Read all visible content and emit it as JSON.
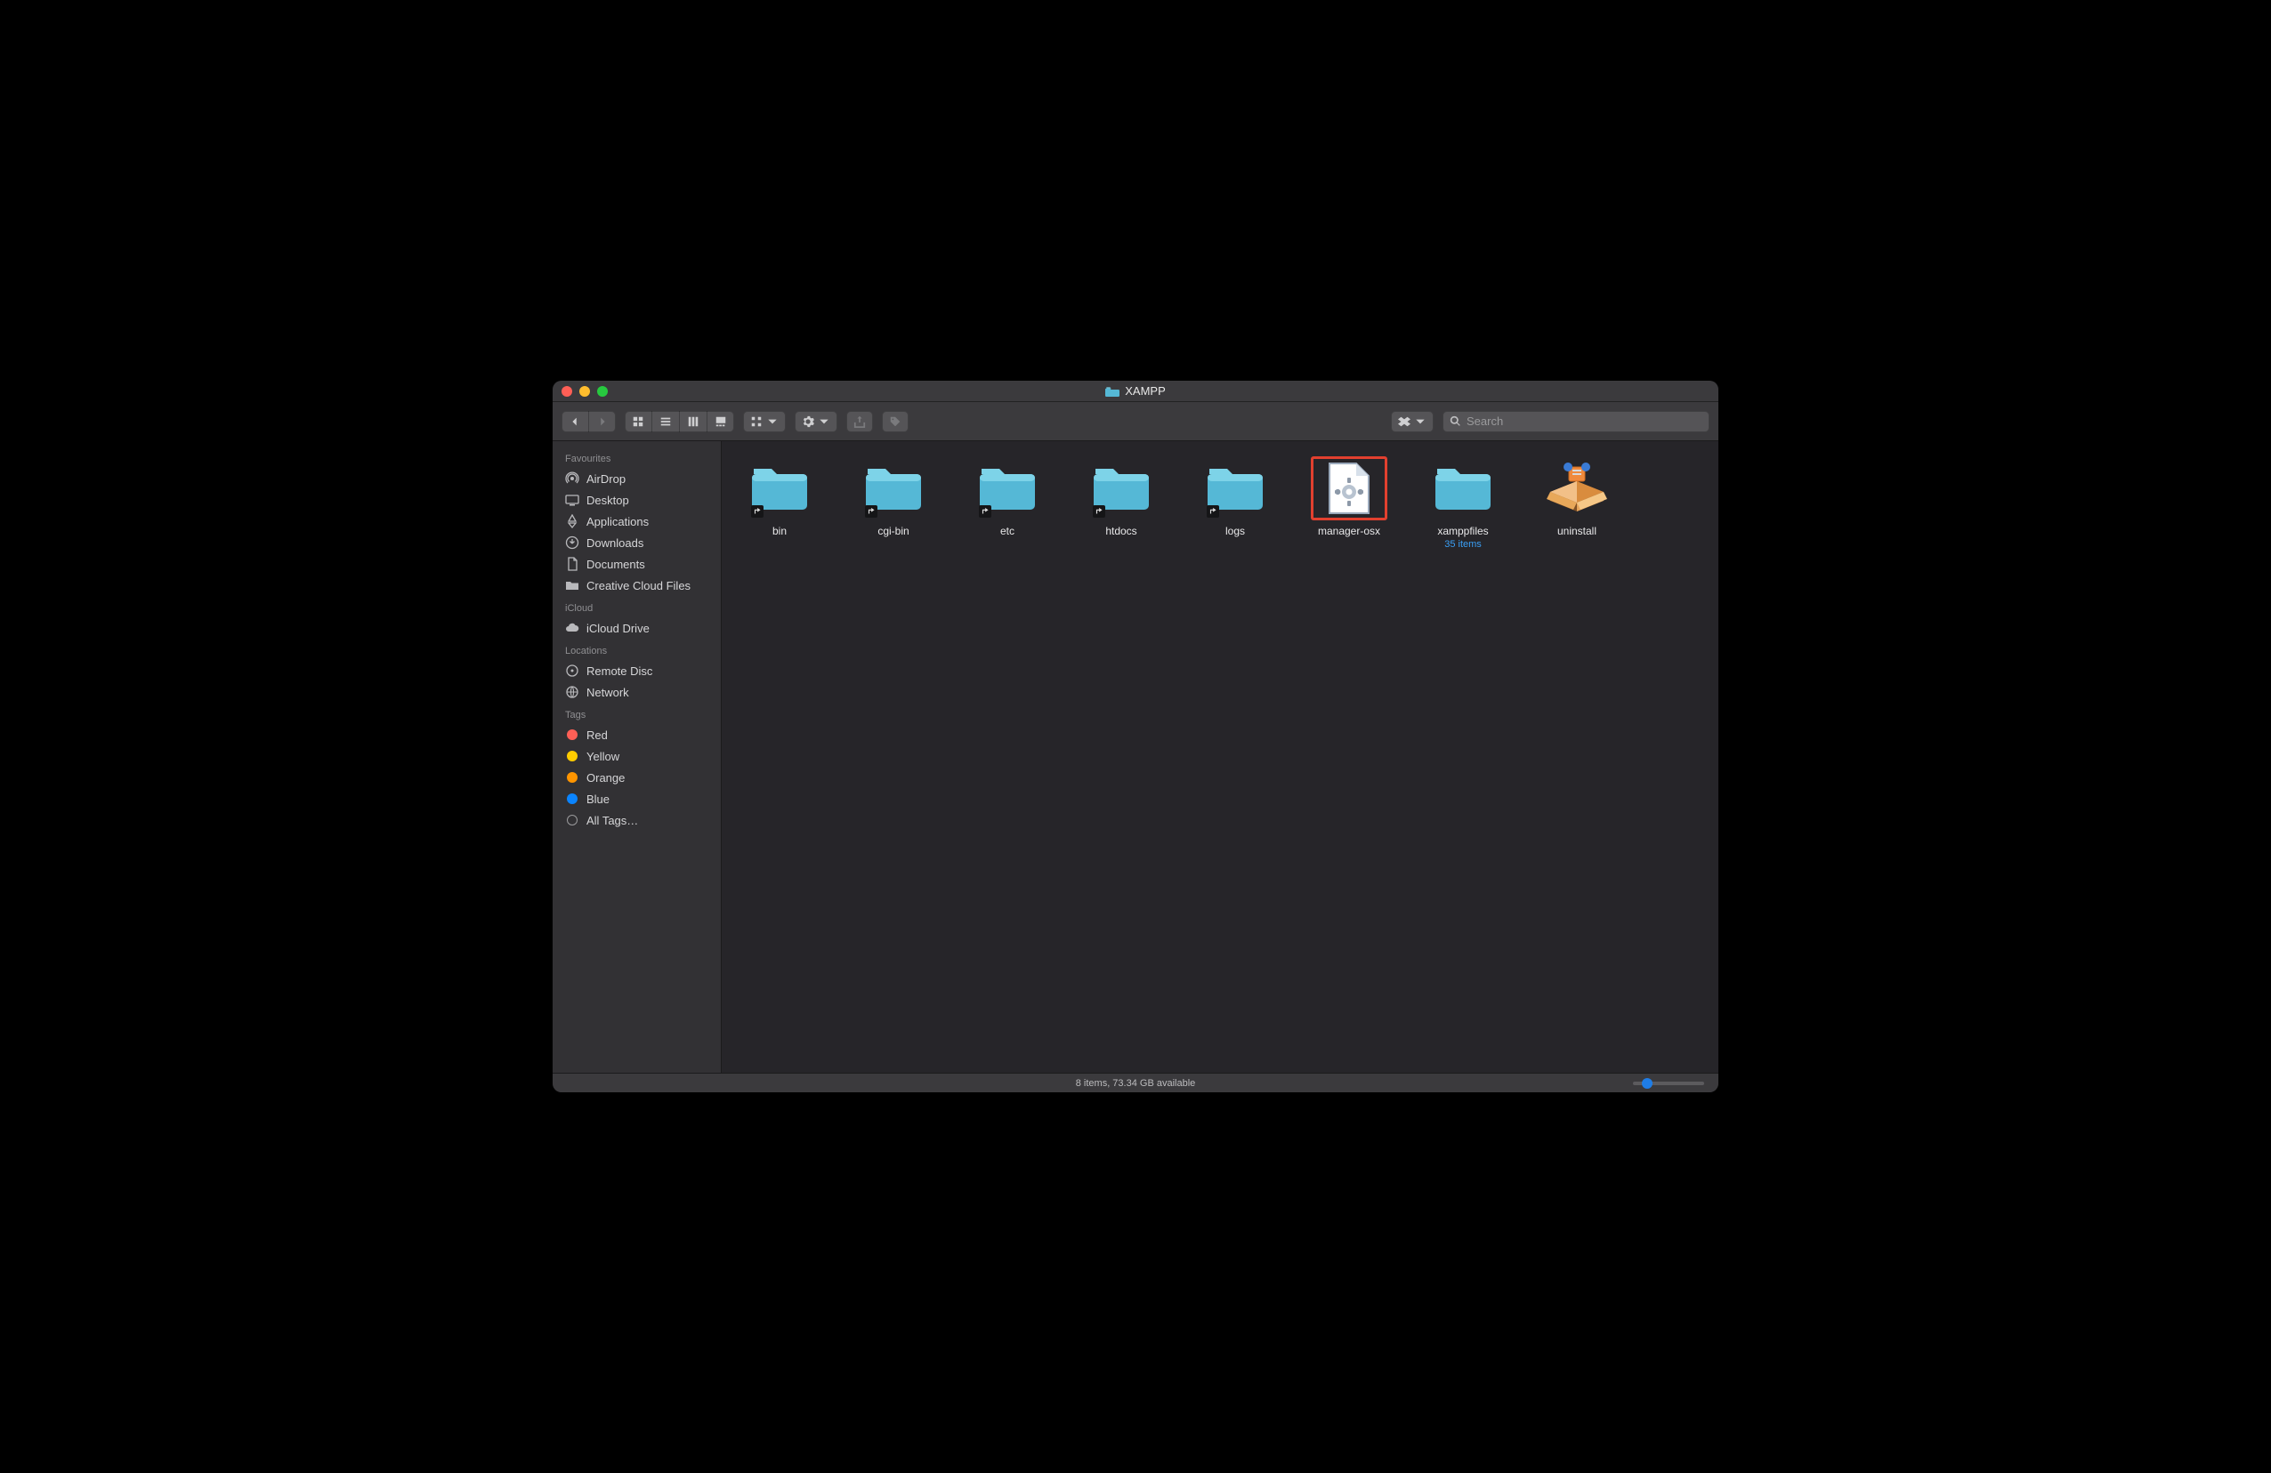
{
  "window": {
    "title": "XAMPP"
  },
  "search": {
    "placeholder": "Search",
    "value": ""
  },
  "sidebar": {
    "sections": [
      {
        "header": "Favourites",
        "items": [
          {
            "icon": "airdrop",
            "label": "AirDrop"
          },
          {
            "icon": "desktop",
            "label": "Desktop"
          },
          {
            "icon": "apps",
            "label": "Applications"
          },
          {
            "icon": "downloads",
            "label": "Downloads"
          },
          {
            "icon": "documents",
            "label": "Documents"
          },
          {
            "icon": "folder",
            "label": "Creative Cloud Files"
          }
        ]
      },
      {
        "header": "iCloud",
        "items": [
          {
            "icon": "icloud",
            "label": "iCloud Drive"
          }
        ]
      },
      {
        "header": "Locations",
        "items": [
          {
            "icon": "disc",
            "label": "Remote Disc"
          },
          {
            "icon": "network",
            "label": "Network"
          }
        ]
      },
      {
        "header": "Tags",
        "items": [
          {
            "icon": "tag",
            "color": "#ff5f56",
            "label": "Red"
          },
          {
            "icon": "tag",
            "color": "#ffcc00",
            "label": "Yellow"
          },
          {
            "icon": "tag",
            "color": "#ff9500",
            "label": "Orange"
          },
          {
            "icon": "tag",
            "color": "#0a84ff",
            "label": "Blue"
          },
          {
            "icon": "tag",
            "color": "hollow",
            "label": "All Tags…"
          }
        ]
      }
    ]
  },
  "items": [
    {
      "name": "bin",
      "type": "folder-alias",
      "highlighted": false
    },
    {
      "name": "cgi-bin",
      "type": "folder-alias",
      "highlighted": false
    },
    {
      "name": "etc",
      "type": "folder-alias",
      "highlighted": false
    },
    {
      "name": "htdocs",
      "type": "folder-alias",
      "highlighted": false
    },
    {
      "name": "logs",
      "type": "folder-alias",
      "highlighted": false
    },
    {
      "name": "manager-osx",
      "type": "app",
      "highlighted": true
    },
    {
      "name": "xamppfiles",
      "type": "folder",
      "highlighted": false,
      "subtitle": "35 items"
    },
    {
      "name": "uninstall",
      "type": "uninstall",
      "highlighted": false
    }
  ],
  "status": {
    "text": "8 items, 73.34 GB available"
  },
  "colors": {
    "folder_top": "#7dd3e8",
    "folder_body": "#55b8d6",
    "highlight_red": "#e2402f"
  }
}
